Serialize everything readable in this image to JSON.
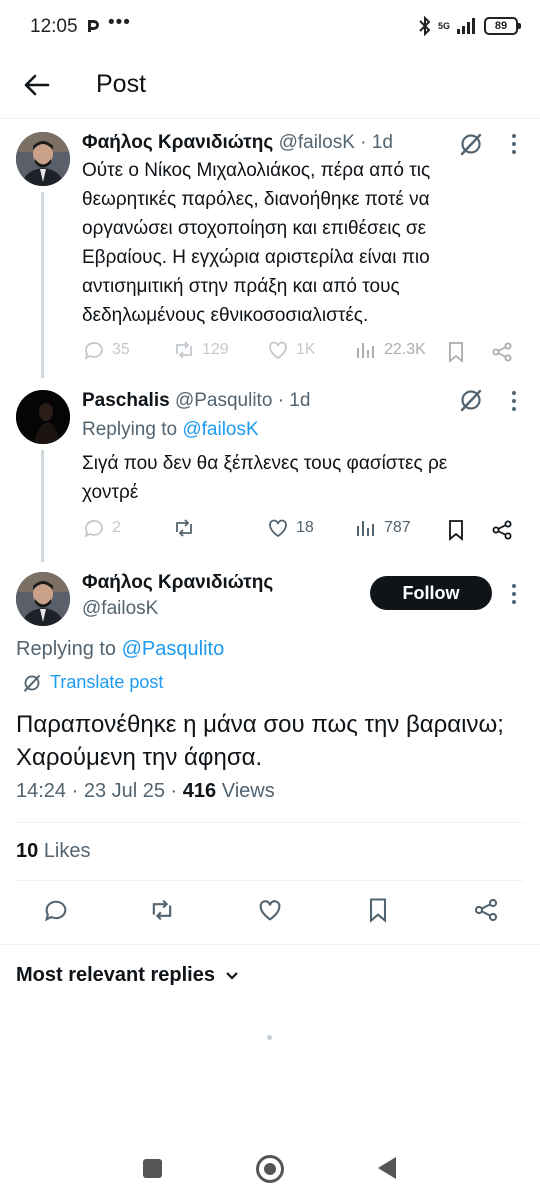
{
  "status_bar": {
    "time": "12:05",
    "dots": "•••",
    "network": "5G",
    "battery": "89"
  },
  "header": {
    "title": "Post"
  },
  "tweets": [
    {
      "name": "Φαήλος Κρανιδιώτης",
      "handle": "@failosK",
      "time": "· 1d",
      "text": "Ούτε ο Νίκος Μιχαλολιάκος, πέρα από τις θεωρητικές παρόλες, διανοήθηκε ποτέ να οργανώσει στοχοποίηση και επιθέσεις σε Εβραίους. Η εγχώρια αριστερίλα είναι πιο αντισημιτική στην πράξη και από τους δεδηλωμένους εθνικοσοσιαλιστές.",
      "replies": "35",
      "reposts": "129",
      "likes": "1K",
      "views": "22.3K"
    },
    {
      "name": "Paschalis",
      "handle": "@Pasqulito",
      "time": "· 1d",
      "replying_prefix": "Replying to",
      "replying_to": "@failosK",
      "text": "Σιγά που δεν θα ξέπλενες τους φασίστες ρε χοντρέ",
      "replies": "2",
      "likes": "18",
      "views": "787"
    }
  ],
  "main_post": {
    "name": "Φαήλος Κρανιδιώτης",
    "handle": "@failosK",
    "follow_label": "Follow",
    "replying_prefix": "Replying to",
    "replying_to": "@Pasqulito",
    "translate_label": "Translate post",
    "text": "Παραπονέθηκε η μάνα σου πως την βαραινω; Χαρούμενη την άφησα.",
    "timestamp": "14:24 · 23 Jul 25 ·",
    "views_count": "416",
    "views_label": "Views",
    "likes_count": "10",
    "likes_label": "Likes"
  },
  "replies_sort": {
    "label": "Most relevant replies"
  },
  "colors": {
    "accent": "#1d9bf0",
    "text": "#0f1419",
    "muted": "#536471",
    "divider": "#eff3f4"
  }
}
